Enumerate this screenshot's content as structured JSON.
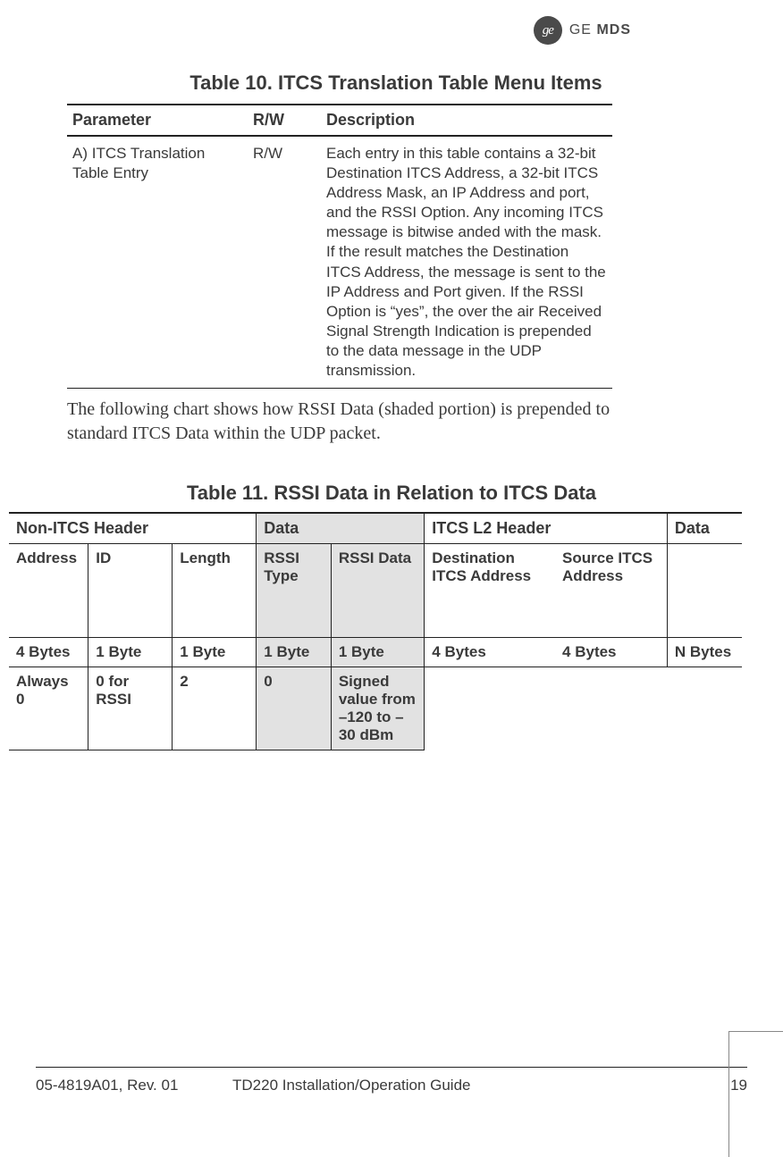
{
  "logo": {
    "mono": "ge",
    "brand": "GE",
    "sub": "MDS"
  },
  "table10": {
    "title": "Table 10. ITCS Translation Table Menu Items",
    "headers": {
      "param": "Parameter",
      "rw": "R/W",
      "desc": "Description"
    },
    "row": {
      "param": "A) ITCS Translation Table Entry",
      "rw": "R/W",
      "desc": "Each entry in this table contains a 32-bit Destination ITCS Address, a 32-bit ITCS Address Mask, an IP Address and port, and the RSSI Option. Any incoming ITCS message is bitwise anded with the mask. If the result matches the Destination ITCS Address, the message is sent to the IP Address and Port given. If the RSSI Option is “yes”, the over the air Received Signal Strength Indication is prepended to the data message in the UDP transmission."
    }
  },
  "body": "The following chart shows how RSSI Data (shaded portion) is prepended to standard ITCS Data within the UDP packet.",
  "table11": {
    "title": "Table 11. RSSI Data in Relation to ITCS Data",
    "groups": {
      "g1": "Non-ITCS Header",
      "g2": "Data",
      "g3": "ITCS L2 Header",
      "g4": "Data"
    },
    "headers": {
      "c1": "Address",
      "c2": "ID",
      "c3": "Length",
      "c4": "RSSI Type",
      "c5": "RSSI Data",
      "c6": "Destination ITCS Address",
      "c7": "Source ITCS Address",
      "c8": ""
    },
    "bytes": {
      "c1": "4 Bytes",
      "c2": "1 Byte",
      "c3": "1 Byte",
      "c4": "1 Byte",
      "c5": "1 Byte",
      "c6": "4 Bytes",
      "c7": "4 Bytes",
      "c8": "N Bytes"
    },
    "values": {
      "c1": "Always 0",
      "c2": "0 for RSSI",
      "c3": "2",
      "c4": "0",
      "c5": "Signed value from –120 to –30 dBm",
      "c6": "",
      "c7": "",
      "c8": ""
    }
  },
  "footer": {
    "docnum": "05-4819A01, Rev. 01",
    "docname": "TD220 Installation/Operation Guide",
    "page": "19"
  }
}
